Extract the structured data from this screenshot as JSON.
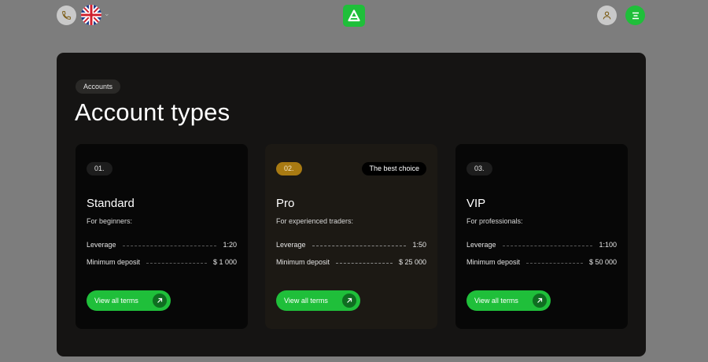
{
  "header": {
    "phone_icon": "phone-icon",
    "flag_icon": "uk-flag-icon",
    "logo_icon": "brand-logo-icon",
    "user_icon": "user-icon",
    "menu_icon": "menu-icon",
    "accent": "#1fbf3a"
  },
  "section": {
    "badge": "Accounts",
    "title": "Account types"
  },
  "cards": [
    {
      "number": "01.",
      "name": "Standard",
      "subtitle": "For beginners:",
      "leverage_label": "Leverage",
      "leverage_value": "1:20",
      "deposit_label": "Minimum deposit",
      "deposit_value": "$ 1 000",
      "cta": "View all terms"
    },
    {
      "number": "02.",
      "tag": "The best choice",
      "name": "Pro",
      "subtitle": "For experienced traders:",
      "leverage_label": "Leverage",
      "leverage_value": "1:50",
      "deposit_label": "Minimum deposit",
      "deposit_value": "$ 25 000",
      "cta": "View all terms"
    },
    {
      "number": "03.",
      "name": "VIP",
      "subtitle": "For professionals:",
      "leverage_label": "Leverage",
      "leverage_value": "1:100",
      "deposit_label": "Minimum deposit",
      "deposit_value": "$ 50 000",
      "cta": "View all terms"
    }
  ]
}
